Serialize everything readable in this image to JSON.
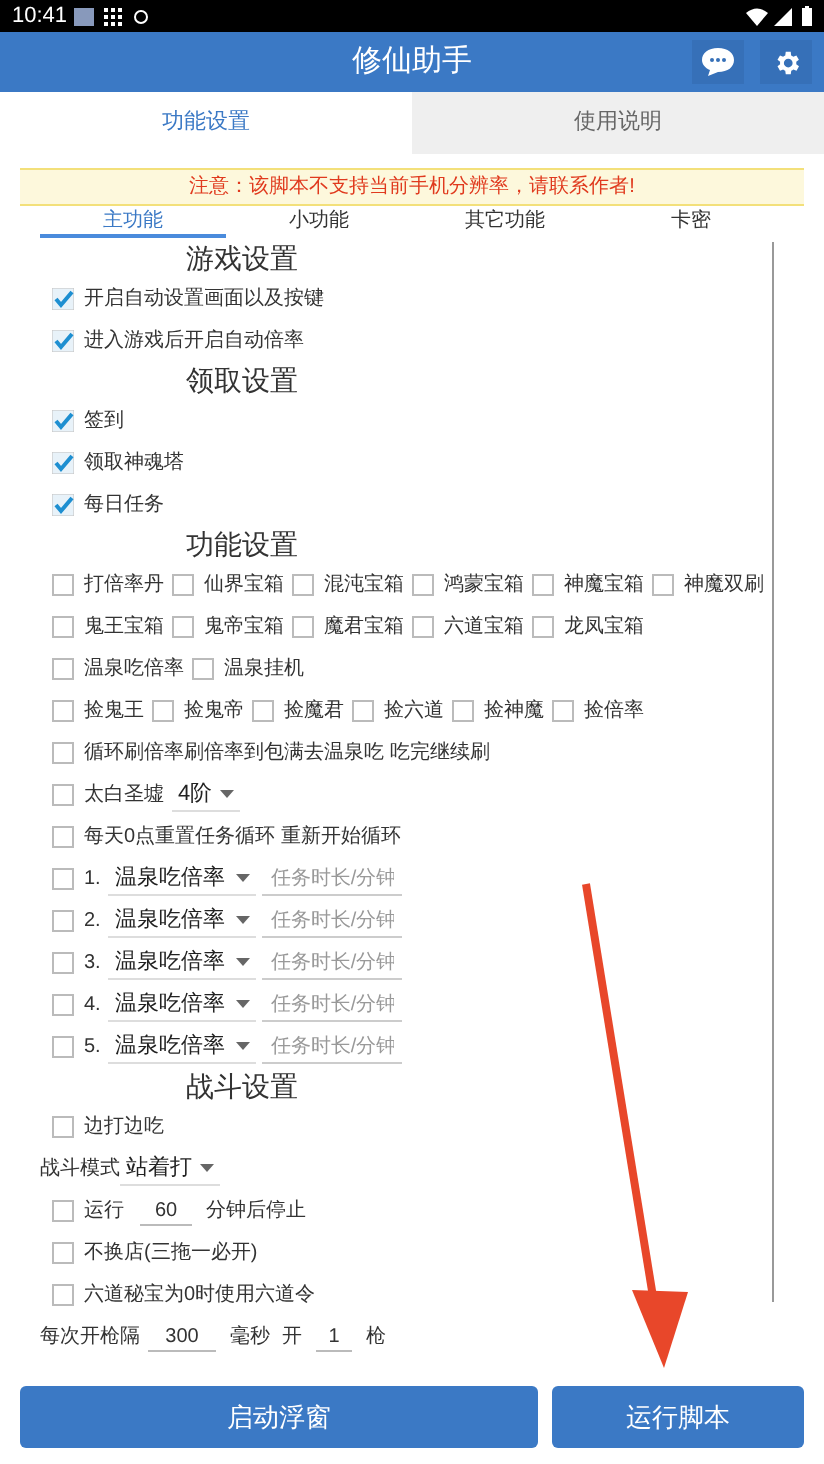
{
  "status_bar": {
    "time": "10:41"
  },
  "app_bar": {
    "title": "修仙助手"
  },
  "tabs": [
    {
      "label": "功能设置",
      "selected": true
    },
    {
      "label": "使用说明",
      "selected": false
    }
  ],
  "notice": "注意：该脚本不支持当前手机分辨率，请联系作者!",
  "sub_tabs": [
    {
      "label": "主功能",
      "selected": true
    },
    {
      "label": "小功能",
      "selected": false
    },
    {
      "label": "其它功能",
      "selected": false
    },
    {
      "label": "卡密",
      "selected": false
    }
  ],
  "sections": [
    {
      "title": "游戏设置",
      "lines": [
        {
          "items": [
            {
              "kind": "checkbox",
              "label": "开启自动设置画面以及按键",
              "checked": true
            }
          ]
        },
        {
          "items": [
            {
              "kind": "checkbox",
              "label": "进入游戏后开启自动倍率",
              "checked": true
            }
          ]
        }
      ]
    },
    {
      "title": "领取设置",
      "lines": [
        {
          "items": [
            {
              "kind": "checkbox",
              "label": "签到",
              "checked": true
            }
          ]
        },
        {
          "items": [
            {
              "kind": "checkbox",
              "label": "领取神魂塔",
              "checked": true
            }
          ]
        },
        {
          "items": [
            {
              "kind": "checkbox",
              "label": "每日任务",
              "checked": true
            }
          ]
        }
      ]
    },
    {
      "title": "功能设置",
      "lines": [
        {
          "items": [
            {
              "kind": "checkbox",
              "label": "打倍率丹",
              "checked": false
            },
            {
              "kind": "checkbox",
              "label": "仙界宝箱",
              "checked": false
            },
            {
              "kind": "checkbox",
              "label": "混沌宝箱",
              "checked": false
            },
            {
              "kind": "checkbox",
              "label": "鸿蒙宝箱",
              "checked": false
            },
            {
              "kind": "checkbox",
              "label": "神魔宝箱",
              "checked": false
            },
            {
              "kind": "checkbox",
              "label": "神魔双刷",
              "checked": false
            }
          ]
        },
        {
          "items": [
            {
              "kind": "checkbox",
              "label": "鬼王宝箱",
              "checked": false
            },
            {
              "kind": "checkbox",
              "label": "鬼帝宝箱",
              "checked": false
            },
            {
              "kind": "checkbox",
              "label": "魔君宝箱",
              "checked": false
            },
            {
              "kind": "checkbox",
              "label": "六道宝箱",
              "checked": false
            },
            {
              "kind": "checkbox",
              "label": "龙凤宝箱",
              "checked": false
            }
          ]
        },
        {
          "items": [
            {
              "kind": "checkbox",
              "label": "温泉吃倍率",
              "checked": false
            },
            {
              "kind": "checkbox",
              "label": "温泉挂机",
              "checked": false
            }
          ]
        },
        {
          "items": [
            {
              "kind": "checkbox",
              "label": "捡鬼王",
              "checked": false
            },
            {
              "kind": "checkbox",
              "label": "捡鬼帝",
              "checked": false
            },
            {
              "kind": "checkbox",
              "label": "捡魔君",
              "checked": false
            },
            {
              "kind": "checkbox",
              "label": "捡六道",
              "checked": false
            },
            {
              "kind": "checkbox",
              "label": "捡神魔",
              "checked": false
            },
            {
              "kind": "checkbox",
              "label": "捡倍率",
              "checked": false
            }
          ]
        },
        {
          "items": [
            {
              "kind": "checkbox",
              "label": "循环刷倍率刷倍率到包满去温泉吃 吃完继续刷",
              "checked": false
            }
          ]
        },
        {
          "items": [
            {
              "kind": "checkbox",
              "label": "太白圣墟",
              "checked": false
            },
            {
              "kind": "select",
              "value": "4阶"
            }
          ]
        },
        {
          "items": [
            {
              "kind": "checkbox",
              "label": "每天0点重置任务循环 重新开始循环",
              "checked": false
            }
          ]
        },
        {
          "items": [
            {
              "kind": "checkbox",
              "label": "1.",
              "checked": false
            },
            {
              "kind": "select",
              "value": "温泉吃倍率"
            },
            {
              "kind": "input",
              "placeholder": "任务时长/分钟"
            }
          ]
        },
        {
          "items": [
            {
              "kind": "checkbox",
              "label": "2.",
              "checked": false
            },
            {
              "kind": "select",
              "value": "温泉吃倍率"
            },
            {
              "kind": "input",
              "placeholder": "任务时长/分钟"
            }
          ]
        },
        {
          "items": [
            {
              "kind": "checkbox",
              "label": "3.",
              "checked": false
            },
            {
              "kind": "select",
              "value": "温泉吃倍率"
            },
            {
              "kind": "input",
              "placeholder": "任务时长/分钟"
            }
          ]
        },
        {
          "items": [
            {
              "kind": "checkbox",
              "label": "4.",
              "checked": false
            },
            {
              "kind": "select",
              "value": "温泉吃倍率"
            },
            {
              "kind": "input",
              "placeholder": "任务时长/分钟"
            }
          ]
        },
        {
          "items": [
            {
              "kind": "checkbox",
              "label": "5.",
              "checked": false
            },
            {
              "kind": "select",
              "value": "温泉吃倍率"
            },
            {
              "kind": "input",
              "placeholder": "任务时长/分钟"
            }
          ]
        }
      ]
    },
    {
      "title": "战斗设置",
      "lines": [
        {
          "items": [
            {
              "kind": "checkbox",
              "label": "边打边吃",
              "checked": false
            }
          ]
        },
        {
          "items": [
            {
              "kind": "text",
              "text": "战斗模式"
            },
            {
              "kind": "select",
              "value": "站着打"
            }
          ]
        },
        {
          "items": [
            {
              "kind": "checkbox",
              "label": "运行",
              "checked": false
            },
            {
              "kind": "input",
              "value": "60"
            },
            {
              "kind": "text",
              "text": "分钟后停止"
            }
          ]
        },
        {
          "items": [
            {
              "kind": "checkbox",
              "label": "不换店(三拖一必开)",
              "checked": false
            }
          ]
        },
        {
          "items": [
            {
              "kind": "checkbox",
              "label": "六道秘宝为0时使用六道令",
              "checked": false
            }
          ]
        },
        {
          "items": [
            {
              "kind": "text",
              "text": "每次开枪隔"
            },
            {
              "kind": "input",
              "value": "300"
            },
            {
              "kind": "text",
              "text": "毫秒"
            },
            {
              "kind": "text",
              "text": "开"
            },
            {
              "kind": "input",
              "value": "1"
            },
            {
              "kind": "text",
              "text": "枪"
            }
          ]
        }
      ]
    }
  ],
  "buttons": [
    {
      "label": "启动浮窗"
    },
    {
      "label": "运行脚本"
    }
  ]
}
